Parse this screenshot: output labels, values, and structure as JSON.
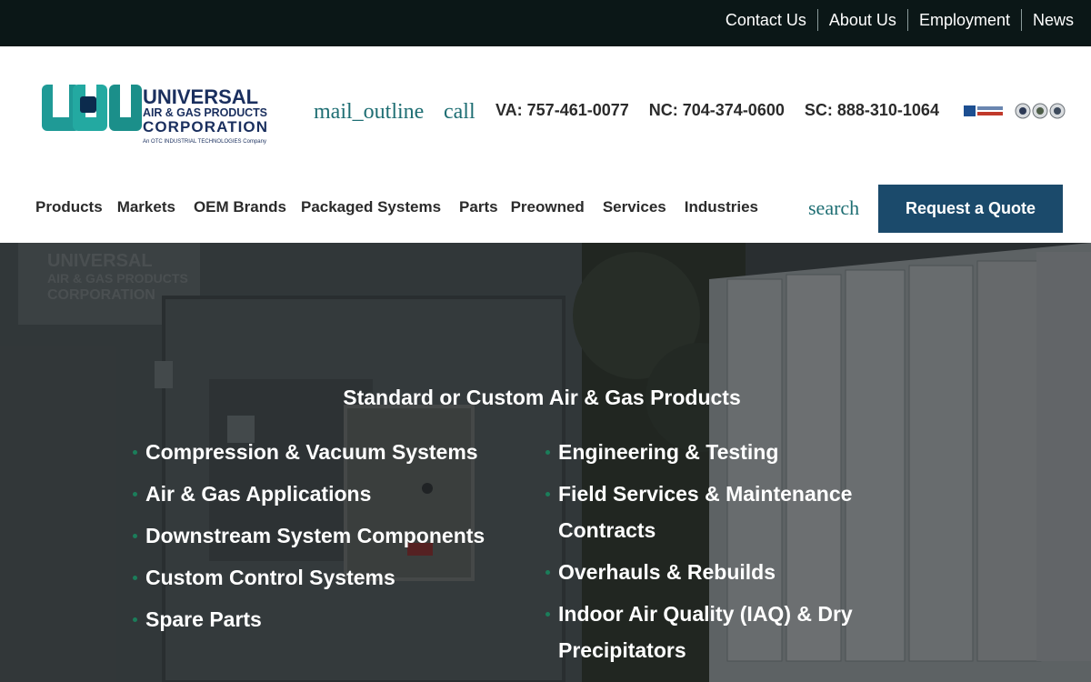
{
  "topnav": {
    "items": [
      "Contact Us",
      "About Us",
      "Employment",
      "News"
    ]
  },
  "header": {
    "logo": {
      "line1": "UNIVERSAL",
      "line2": "AIR & GAS PRODUCTS",
      "line3": "CORPORATION",
      "tagline": "An OTC INDUSTRIAL TECHNOLOGIES Company"
    },
    "mail_icon": "mail_outline",
    "call_icon": "call",
    "phones": [
      "VA: 757-461-0077",
      "NC: 704-374-0600",
      "SC: 888-310-1064"
    ],
    "badges": [
      "gsa-advantage-badge",
      "seal-icon",
      "seal-icon",
      "seal-icon"
    ]
  },
  "mainnav": {
    "items": [
      "Products",
      "Markets",
      "OEM Brands",
      "Packaged Systems",
      "Parts",
      "Preowned",
      "Services",
      "Industries"
    ],
    "search_icon": "search",
    "quote_button": "Request a Quote"
  },
  "hero": {
    "title": "Standard or Custom Air & Gas Products",
    "left_list": [
      "Compression & Vacuum Systems",
      "Air & Gas Applications",
      "Downstream System Components",
      "Custom Control Systems",
      "Spare Parts"
    ],
    "right_list": [
      "Engineering & Testing",
      "Field Services & Maintenance Contracts",
      "Overhauls & Rebuilds",
      "Indoor Air Quality (IAQ) & Dry Precipitators"
    ],
    "photo_text": [
      "UNIVERSAL",
      "AIR & GAS PRODUCTS",
      "CORPORATION"
    ]
  },
  "colors": {
    "topbar": "#0b1717",
    "accent_teal": "#1e6e73",
    "button": "#1b4a6b",
    "logo_navy": "#1a2f5e",
    "bullet": "#1b7d5a"
  }
}
